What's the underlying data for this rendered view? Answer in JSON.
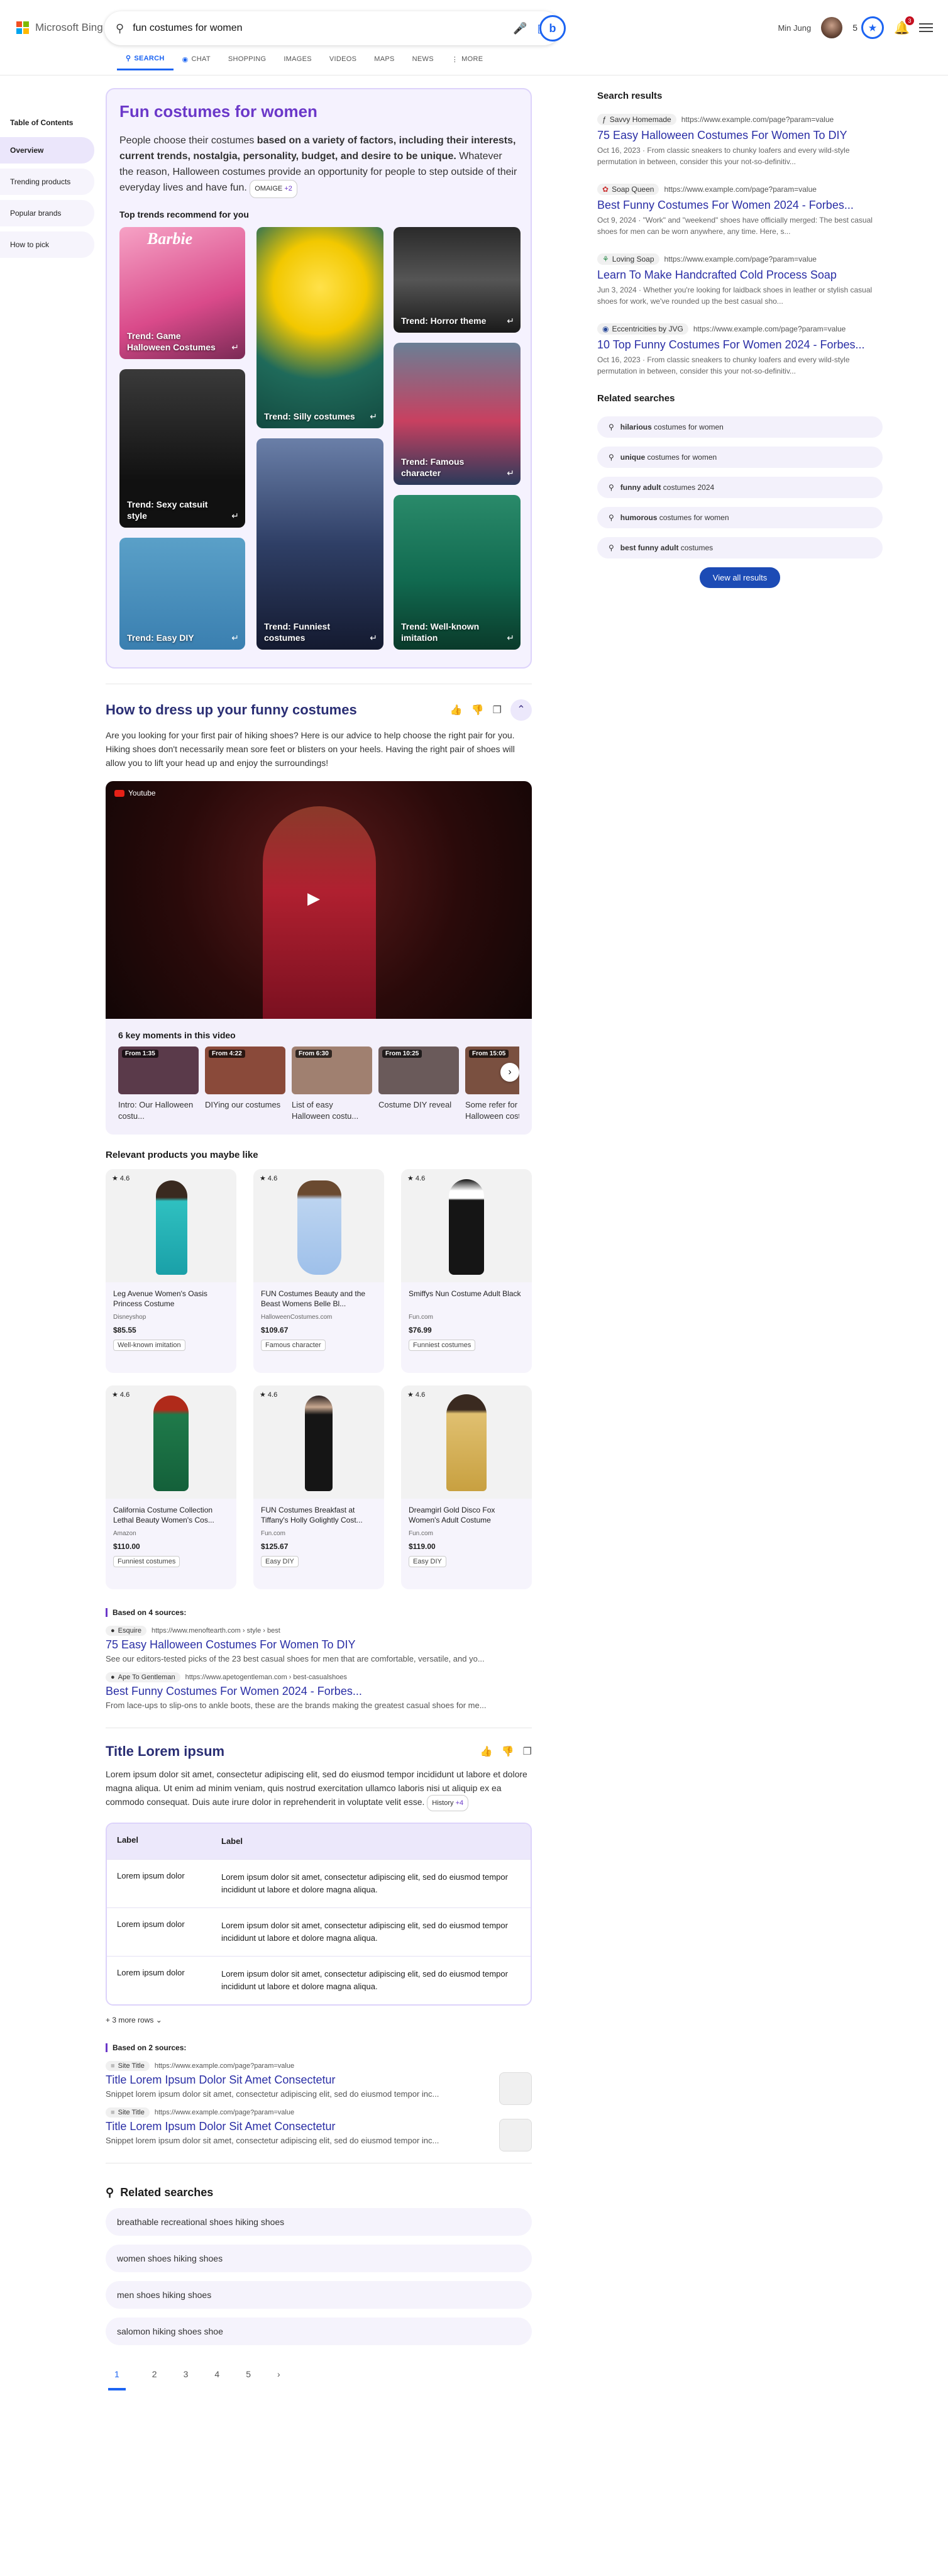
{
  "header": {
    "logo": "Microsoft Bing",
    "query": "fun costumes for women",
    "user_name": "Min Jung",
    "points": "5",
    "notifications": "3"
  },
  "nav": [
    {
      "label": "SEARCH",
      "icon": "search-icon"
    },
    {
      "label": "CHAT",
      "icon": "chat-icon"
    },
    {
      "label": "SHOPPING"
    },
    {
      "label": "IMAGES"
    },
    {
      "label": "VIDEOS"
    },
    {
      "label": "MAPS"
    },
    {
      "label": "NEWS"
    },
    {
      "label": "MORE",
      "icon": "more-icon"
    }
  ],
  "toc": {
    "title": "Table of Contents",
    "items": [
      "Overview",
      "Trending products",
      "Popular brands",
      "How to pick"
    ]
  },
  "overview": {
    "title": "Fun costumes for women",
    "intro_a": "People choose their costumes ",
    "intro_b": "based on a variety of factors, including their interests, current trends, nostalgia, personality, budget, and desire to be unique.",
    "intro_c": " Whatever the reason, Halloween costumes provide an opportunity for people to step outside of their everyday lives and have fun.",
    "source_chip": "OMAIGE",
    "source_more": "+2",
    "trends_heading": "Top trends recommend for you",
    "trends": [
      "Trend: Game Halloween Costumes",
      "Trend: Silly costumes",
      "Trend: Horror theme",
      "Trend: Sexy catsuit style",
      "Trend: Famous character",
      "Trend: Funniest costumes",
      "Trend: Easy DIY",
      "Trend: Well-known imitation"
    ]
  },
  "dress": {
    "title": "How to dress up your funny costumes",
    "paragraph": "Are you looking for your first pair of hiking shoes? Here is our advice to help choose the right pair for you. Hiking shoes don't necessarily mean sore feet or blisters on your heels. Having the right pair of shoes will allow you to lift your head up and enjoy the surroundings!",
    "video_source": "Youtube",
    "moments_heading": "6 key moments in this video",
    "moments": [
      {
        "from": "From 1:35",
        "caption": "Intro: Our Halloween costu..."
      },
      {
        "from": "From 4:22",
        "caption": "DIYing our costumes"
      },
      {
        "from": "From 6:30",
        "caption": "List of easy Halloween costu..."
      },
      {
        "from": "From 10:25",
        "caption": "Costume DIY reveal"
      },
      {
        "from": "From 15:05",
        "caption": "Some refer for Halloween cost..."
      }
    ]
  },
  "products": {
    "heading": "Relevant products you maybe like",
    "items": [
      {
        "rating": "4.6",
        "name": "Leg Avenue Women's Oasis Princess Costume",
        "seller": "Disneyshop",
        "price": "$85.55",
        "tag": "Well-known imitation"
      },
      {
        "rating": "4.6",
        "name": "FUN Costumes Beauty and the Beast Womens Belle Bl...",
        "seller": "HalloweenCostumes.com",
        "price": "$109.67",
        "tag": "Famous character"
      },
      {
        "rating": "4.6",
        "name": "Smiffys Nun Costume Adult Black",
        "seller": "Fun.com",
        "price": "$76.99",
        "tag": "Funniest costumes"
      },
      {
        "rating": "4.6",
        "name": "California Costume Collection Lethal Beauty Women's Cos...",
        "seller": "Amazon",
        "price": "$110.00",
        "tag": "Funniest costumes"
      },
      {
        "rating": "4.6",
        "name": "FUN Costumes Breakfast at Tiffany's Holly Golightly Cost...",
        "seller": "Fun.com",
        "price": "$125.67",
        "tag": "Easy DIY"
      },
      {
        "rating": "4.6",
        "name": "Dreamgirl Gold Disco Fox Women's Adult Costume",
        "seller": "Fun.com",
        "price": "$119.00",
        "tag": "Easy DIY"
      }
    ]
  },
  "sources1": {
    "heading": "Based on 4 sources:",
    "items": [
      {
        "site": "Esquire",
        "url": "https://www.menoftearth.com › style › best",
        "title": "75 Easy Halloween Costumes For Women To DIY",
        "snippet": "See our editors-tested picks of the 23 best casual shoes for men that are comfortable, versatile, and yo..."
      },
      {
        "site": "Ape To Gentleman",
        "url": "https://www.apetogentleman.com › best-casualshoes",
        "title": "Best Funny Costumes For Women 2024 - Forbes...",
        "snippet": "From lace-ups to slip-ons to ankle boots, these are the brands making the greatest casual shoes for me..."
      }
    ]
  },
  "lorem": {
    "title": "Title Lorem ipsum",
    "paragraph": "Lorem ipsum dolor sit amet, consectetur adipiscing elit, sed do eiusmod tempor incididunt ut labore et dolore magna aliqua. Ut enim ad minim veniam, quis nostrud exercitation ullamco laboris nisi ut aliquip ex ea commodo consequat. Duis aute irure dolor in reprehenderit in voluptate velit esse.",
    "chip": "History",
    "chip_more": "+4",
    "table_header": [
      "Label",
      "Label"
    ],
    "rows": [
      [
        "Lorem ipsum dolor",
        "Lorem ipsum dolor sit amet, consectetur adipiscing elit, sed do eiusmod tempor incididunt ut labore et dolore magna aliqua."
      ],
      [
        "Lorem ipsum dolor",
        "Lorem ipsum dolor sit amet, consectetur adipiscing elit, sed do eiusmod tempor incididunt ut labore et dolore magna aliqua."
      ],
      [
        "Lorem ipsum dolor",
        "Lorem ipsum dolor sit amet, consectetur adipiscing elit, sed do eiusmod tempor incididunt ut labore et dolore magna aliqua."
      ]
    ],
    "more_rows": "+ 3 more rows"
  },
  "sources2": {
    "heading": "Based on 2 sources:",
    "items": [
      {
        "site": "Site Title",
        "url": "https://www.example.com/page?param=value",
        "title": "Title Lorem Ipsum Dolor Sit Amet Consectetur",
        "snippet": "Snippet lorem ipsum dolor sit amet, consectetur adipiscing elit, sed do eiusmod tempor inc..."
      },
      {
        "site": "Site Title",
        "url": "https://www.example.com/page?param=value",
        "title": "Title Lorem Ipsum Dolor Sit Amet Consectetur",
        "snippet": "Snippet lorem ipsum dolor sit amet, consectetur adipiscing elit, sed do eiusmod tempor inc..."
      }
    ]
  },
  "related_main": {
    "heading": "Related searches",
    "items": [
      "breathable recreational shoes hiking shoes",
      "women shoes hiking shoes",
      "men shoes hiking shoes",
      "salomon hiking shoes shoe"
    ]
  },
  "pager": [
    "1",
    "2",
    "3",
    "4",
    "5"
  ],
  "side": {
    "heading": "Search results",
    "results": [
      {
        "site": "Savvy Homemade",
        "url": "https://www.example.com/page?param=value",
        "title": "75 Easy Halloween Costumes For Women To DIY",
        "snippet": "Oct 16, 2023 · From classic sneakers to chunky loafers and every wild-style permutation in between, consider this your not-so-definitiv..."
      },
      {
        "site": "Soap Queen",
        "url": "https://www.example.com/page?param=value",
        "title": "Best Funny Costumes For Women 2024 - Forbes...",
        "snippet": "Oct 9, 2024 · \"Work\" and \"weekend\" shoes have officially merged: The best casual shoes for men can be worn anywhere, any time. Here, s..."
      },
      {
        "site": "Loving Soap",
        "url": "https://www.example.com/page?param=value",
        "title": "Learn To Make Handcrafted Cold Process Soap",
        "snippet": "Jun 3, 2024 · Whether you're looking for laidback shoes in leather or stylish casual shoes for work, we've rounded up the best casual sho..."
      },
      {
        "site": "Eccentricities by JVG",
        "url": "https://www.example.com/page?param=value",
        "title": "10 Top Funny Costumes For Women 2024 - Forbes...",
        "snippet": "Oct 16, 2023 · From classic sneakers to chunky loafers and every wild-style permutation in between, consider this your not-so-definitiv..."
      }
    ],
    "related_heading": "Related searches",
    "related": [
      {
        "bold": "hilarious",
        "rest": " costumes for women"
      },
      {
        "bold": "unique",
        "rest": " costumes for women"
      },
      {
        "bold": "funny adult",
        "rest": " costumes 2024"
      },
      {
        "bold": "humorous",
        "rest": " costumes for women"
      },
      {
        "bold": "best funny adult",
        "rest": " costumes"
      }
    ],
    "view_all": "View all results"
  },
  "colors": {
    "accent": "#6b38c9",
    "link": "#2a2ea5",
    "brand_blue": "#1c64f2"
  }
}
